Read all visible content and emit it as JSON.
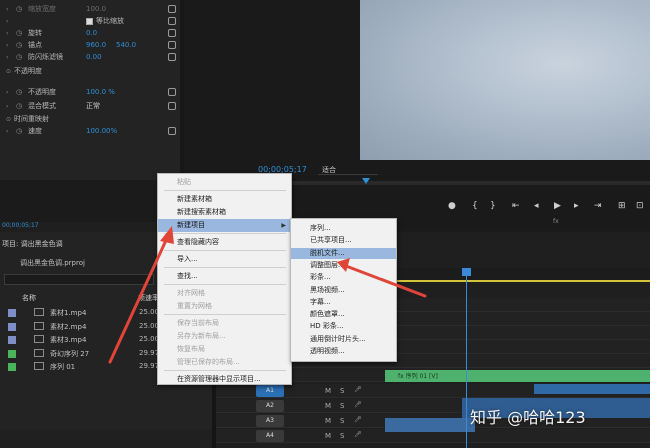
{
  "effect_controls": {
    "rows": [
      {
        "label": "缩放宽度",
        "v1": "100.0",
        "dim": true
      },
      {
        "label": "等比缩放",
        "checkbox": true
      },
      {
        "label": "旋转",
        "v1": "0.0"
      },
      {
        "label": "锚点",
        "v1": "960.0",
        "v2": "540.0"
      },
      {
        "label": "防闪烁滤镜",
        "v1": "0.00"
      },
      {
        "label": "不透明度",
        "section": true
      },
      {
        "label": "不透明度",
        "v1": "100.0 %"
      },
      {
        "label": "混合模式",
        "v1": "正常",
        "dropdown": true
      },
      {
        "label": "时间重映射",
        "section": true
      },
      {
        "label": "速度",
        "v1": "100.00%"
      }
    ],
    "timecode": "00;00;05;17"
  },
  "program_monitor": {
    "timecode": "00;00;05;17",
    "fit": "适合",
    "fx_label": "fx"
  },
  "project_panel": {
    "tab": "项目: 调出黑金色调",
    "file": "调出黑金色调.prproj",
    "col_name": "名称",
    "col_framerate": "帧速率",
    "items": [
      {
        "name": "素材1.mp4",
        "fps": "25.00",
        "color": "#7f8fc6"
      },
      {
        "name": "素材2.mp4",
        "fps": "25.00",
        "color": "#7f8fc6"
      },
      {
        "name": "素材3.mp4",
        "fps": "25.00",
        "color": "#7f8fc6"
      },
      {
        "name": "奇幻序列 27",
        "fps": "29.97",
        "color": "#4bb35a"
      },
      {
        "name": "序列 01",
        "fps": "29.97",
        "color": "#4bb35a"
      }
    ]
  },
  "context_menu": {
    "items": [
      {
        "label": "粘贴",
        "disabled": true
      },
      {
        "sep": true
      },
      {
        "label": "新建素材箱"
      },
      {
        "label": "新建搜索素材箱"
      },
      {
        "label": "新建项目",
        "highlight": true,
        "submenu": true
      },
      {
        "sep": true
      },
      {
        "label": "查看隐藏内容"
      },
      {
        "sep": true
      },
      {
        "label": "导入..."
      },
      {
        "sep": true
      },
      {
        "label": "查找..."
      },
      {
        "sep": true
      },
      {
        "label": "对齐网格",
        "disabled": true
      },
      {
        "label": "重置为网格",
        "disabled": true
      },
      {
        "sep": true
      },
      {
        "label": "保存当前布局",
        "disabled": true
      },
      {
        "label": "另存为新布局...",
        "disabled": true
      },
      {
        "label": "恢复布局",
        "disabled": true
      },
      {
        "label": "管理已保存的布局...",
        "disabled": true
      },
      {
        "sep": true
      },
      {
        "label": "在资源管理器中显示项目..."
      }
    ]
  },
  "submenu": {
    "items": [
      {
        "label": "序列..."
      },
      {
        "label": "已共享项目..."
      },
      {
        "label": "脱机文件...",
        "highlight": true
      },
      {
        "label": "调整图层..."
      },
      {
        "label": "彩条..."
      },
      {
        "label": "黑场视频..."
      },
      {
        "label": "字幕..."
      },
      {
        "label": "颜色遮罩..."
      },
      {
        "label": "HD 彩条..."
      },
      {
        "label": "通用倒计时片头..."
      },
      {
        "label": "透明视频..."
      }
    ]
  },
  "timeline": {
    "tracks": [
      "A1",
      "A2",
      "A3",
      "A4"
    ],
    "clip_label": "fx 序列 01 [V]",
    "controls": [
      "M",
      "S"
    ]
  },
  "watermark": "知乎 @哈哈123",
  "colors": {
    "accent": "#2f8fd6",
    "arrow": "#e0453a",
    "menu_highlight": "#9ab8df"
  }
}
